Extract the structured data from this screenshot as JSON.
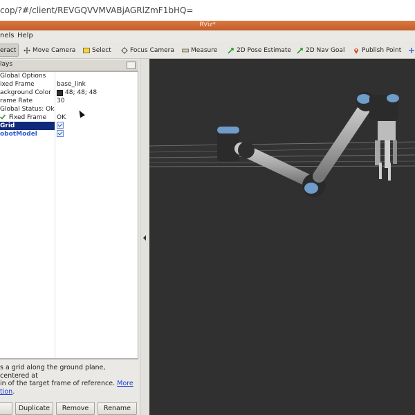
{
  "browser": {
    "url": "cop/?#/client/REVGQVVMVABjAGRlZmF1bHQ="
  },
  "window": {
    "title": "RViz*"
  },
  "menus": [
    {
      "label": "nels"
    },
    {
      "label": "Help"
    }
  ],
  "toolbar": {
    "tools": [
      {
        "label": "eract",
        "icon": "interact-icon",
        "active": true
      },
      {
        "label": "Move Camera",
        "icon": "move-camera-icon"
      },
      {
        "label": "Select",
        "icon": "select-icon"
      },
      {
        "label": "Focus Camera",
        "icon": "focus-camera-icon"
      },
      {
        "label": "Measure",
        "icon": "measure-icon"
      },
      {
        "label": "2D Pose Estimate",
        "icon": "pose-estimate-icon"
      },
      {
        "label": "2D Nav Goal",
        "icon": "nav-goal-icon"
      },
      {
        "label": "Publish Point",
        "icon": "publish-point-icon"
      }
    ]
  },
  "displays_panel": {
    "title": "lays",
    "rows": [
      {
        "key": "Global Options",
        "value": ""
      },
      {
        "key": "ixed Frame",
        "value": "base_link"
      },
      {
        "key": "ackground Color",
        "value": "48; 48; 48"
      },
      {
        "key": "rame Rate",
        "value": "30"
      },
      {
        "key": "Global Status: Ok",
        "value": ""
      },
      {
        "key": "Fixed Frame",
        "value": "OK"
      },
      {
        "key": "Grid",
        "value": ""
      },
      {
        "key": "obotModel",
        "value": ""
      }
    ],
    "description_prefix": "s a grid along the ground plane, centered at",
    "description_line2": "in of the target frame of reference.",
    "description_link1": "More",
    "description_link2": "tion",
    "description_end": "."
  },
  "buttons": {
    "add": "",
    "duplicate": "Duplicate",
    "remove": "Remove",
    "rename": "Rename"
  },
  "colors": {
    "background": "#303030",
    "link": "#60a0d8",
    "grey": "#808080",
    "selection": "#0f2a7a",
    "title_bar": "#c45e2a"
  }
}
